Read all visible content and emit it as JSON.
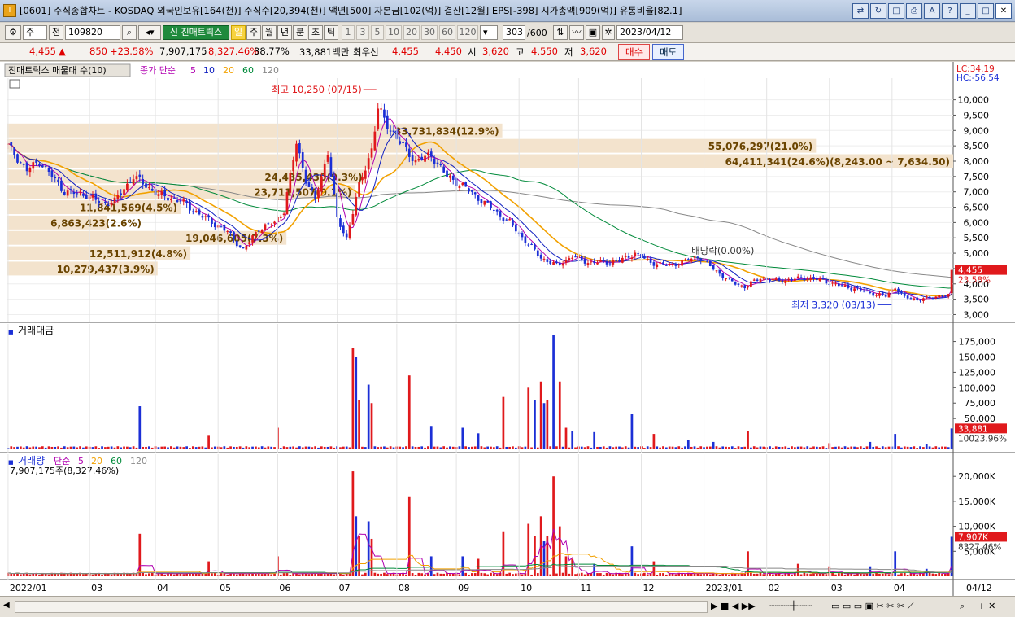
{
  "window": {
    "title": "[0601] 주식종합차트 - KOSDAQ 외국인보유[164(천)] 주식수[20,394(천)] 액면[500] 자본금[102(억)] 결산[12월] EPS[-398] 시가총액[909(억)] 유통비율[82.1]",
    "icon": "I"
  },
  "toolbar": {
    "mode": "주",
    "ex_label": "전",
    "code": "109820",
    "tracks_button": "신 진매트릭스",
    "periods": [
      "일",
      "주",
      "월",
      "년",
      "분",
      "초",
      "틱"
    ],
    "active_period": "일",
    "minute_options": [
      "1",
      "3",
      "5",
      "10",
      "20",
      "30",
      "60",
      "120"
    ],
    "count": "303",
    "count_total": "/600",
    "date": "2023/04/12"
  },
  "quote": {
    "price": "4,455",
    "change": "850",
    "change_pct": "+23.58%",
    "volume": "7,907,175",
    "volume_pct": "8,327.46%",
    "ratio": "38.77%",
    "amount": "33,881백만",
    "best_label": "최우선",
    "best_ask": "4,455",
    "best_bid": "4,450",
    "open_label": "시",
    "open": "3,620",
    "high_label": "고",
    "high": "4,550",
    "low_label": "저",
    "low": "3,620",
    "buy_label": "매수",
    "sell_label": "매도"
  },
  "colors": {
    "up": "#e0191c",
    "down": "#1b2fd6",
    "ma5": "#b000b0",
    "ma10": "#1020c0",
    "ma20": "#f2a100",
    "ma60": "#008a3a",
    "ma120": "#888888",
    "volume_profile": "#f3e3cd"
  },
  "chart_data": [
    {
      "type": "candlestick",
      "panel": "price",
      "legend_title": "진매트릭스 매물대 수(10)",
      "ma_label": "종가 단순",
      "ma_periods": [
        "5",
        "10",
        "20",
        "60",
        "120"
      ],
      "ylim": [
        2800,
        10600
      ],
      "yticks": [
        "10,000",
        "9,500",
        "9,000",
        "8,500",
        "8,000",
        "7,500",
        "7,000",
        "6,500",
        "6,000",
        "5,500",
        "5,000",
        "4,500",
        "4,000",
        "3,500",
        "3,000"
      ],
      "ytick_values": [
        10000,
        9500,
        9000,
        8500,
        8000,
        7500,
        7000,
        6500,
        6000,
        5500,
        5000,
        4500,
        4000,
        3500,
        3000
      ],
      "x_labels": [
        "2022/01",
        "03",
        "04",
        "05",
        "06",
        "07",
        "08",
        "09",
        "10",
        "11",
        "12",
        "2023/01",
        "02",
        "03",
        "04",
        "04/12"
      ],
      "right_top_labels": [
        "LC:34.19",
        "HC:-56.54"
      ],
      "current_price_label": "4,455",
      "current_pct_label": "23.58%",
      "current_price": 4455,
      "max_annotation": "최고 10,250 (07/15)",
      "min_annotation": "최저 3,320 (03/13)",
      "dividend_annotation": "배당락(0.00%)",
      "price_keypoints": [
        [
          0,
          8500
        ],
        [
          6,
          7700
        ],
        [
          10,
          8000
        ],
        [
          18,
          7000
        ],
        [
          25,
          6900
        ],
        [
          30,
          6600
        ],
        [
          34,
          6700
        ],
        [
          40,
          7500
        ],
        [
          48,
          6900
        ],
        [
          55,
          6700
        ],
        [
          62,
          6200
        ],
        [
          70,
          5700
        ],
        [
          75,
          5100
        ],
        [
          80,
          5800
        ],
        [
          85,
          6000
        ],
        [
          88,
          6400
        ],
        [
          92,
          8600
        ],
        [
          95,
          7400
        ],
        [
          98,
          6700
        ],
        [
          102,
          8300
        ],
        [
          105,
          6100
        ],
        [
          108,
          5500
        ],
        [
          112,
          7200
        ],
        [
          116,
          8400
        ],
        [
          118,
          9700
        ],
        [
          121,
          9200
        ],
        [
          125,
          8600
        ],
        [
          130,
          8000
        ],
        [
          135,
          8200
        ],
        [
          140,
          7500
        ],
        [
          145,
          7200
        ],
        [
          150,
          6800
        ],
        [
          155,
          6400
        ],
        [
          160,
          6000
        ],
        [
          165,
          5400
        ],
        [
          170,
          4850
        ],
        [
          175,
          4600
        ],
        [
          180,
          4900
        ],
        [
          185,
          4700
        ],
        [
          190,
          4700
        ],
        [
          195,
          4750
        ],
        [
          200,
          5000
        ],
        [
          205,
          4700
        ],
        [
          210,
          4600
        ],
        [
          215,
          4700
        ],
        [
          220,
          4900
        ],
        [
          225,
          4500
        ],
        [
          230,
          4100
        ],
        [
          235,
          3900
        ],
        [
          240,
          4200
        ],
        [
          245,
          4100
        ],
        [
          250,
          4150
        ],
        [
          255,
          4200
        ],
        [
          260,
          4100
        ],
        [
          265,
          3950
        ],
        [
          270,
          3850
        ],
        [
          275,
          3700
        ],
        [
          280,
          3600
        ],
        [
          283,
          3900
        ],
        [
          286,
          3550
        ],
        [
          290,
          3500
        ],
        [
          295,
          3550
        ],
        [
          298,
          3650
        ],
        [
          300,
          3605
        ],
        [
          301,
          4455
        ]
      ],
      "volume_profile": [
        {
          "label": "33,731,834(12.9%)",
          "price": 9000,
          "amount": 33731834
        },
        {
          "label": "55,076,297(21.0%)",
          "price": 8500,
          "amount": 55076297
        },
        {
          "label": "64,411,341(24.6%)(8,243.00 ~ 7,634.50)",
          "price": 8000,
          "amount": 64411341
        },
        {
          "label": "24,435,430(9.3%)",
          "price": 7500,
          "amount": 24435430
        },
        {
          "label": "23,711,507(9.1%)",
          "price": 7000,
          "amount": 23711507
        },
        {
          "label": "11,841,569(4.5%)",
          "price": 6500,
          "amount": 11841569
        },
        {
          "label": "6,863,423(2.6%)",
          "price": 6000,
          "amount": 6863423
        },
        {
          "label": "19,046,605(7.3%)",
          "price": 5500,
          "amount": 19046605
        },
        {
          "label": "12,511,912(4.8%)",
          "price": 5000,
          "amount": 12511912
        },
        {
          "label": "10,279,437(3.9%)",
          "price": 4500,
          "amount": 10279437
        }
      ]
    },
    {
      "type": "bar",
      "panel": "amount",
      "title": "거래대금",
      "ylim": [
        0,
        185000
      ],
      "yticks": [
        "175,000",
        "150,000",
        "125,000",
        "100,000",
        "75,000",
        "50,000"
      ],
      "ytick_values": [
        175000,
        150000,
        125000,
        100000,
        75000,
        50000
      ],
      "current_label": "33,881",
      "ma_label": "10023.96%",
      "spikes": [
        [
          42,
          70000
        ],
        [
          64,
          22000
        ],
        [
          86,
          35000
        ],
        [
          110,
          165000
        ],
        [
          111,
          150000
        ],
        [
          112,
          80000
        ],
        [
          115,
          105000
        ],
        [
          116,
          75000
        ],
        [
          128,
          120000
        ],
        [
          135,
          38000
        ],
        [
          145,
          35000
        ],
        [
          150,
          26000
        ],
        [
          158,
          85000
        ],
        [
          166,
          100000
        ],
        [
          168,
          80000
        ],
        [
          170,
          110000
        ],
        [
          171,
          75000
        ],
        [
          172,
          80000
        ],
        [
          174,
          185000
        ],
        [
          176,
          110000
        ],
        [
          178,
          35000
        ],
        [
          180,
          30000
        ],
        [
          187,
          28000
        ],
        [
          199,
          58000
        ],
        [
          206,
          25000
        ],
        [
          217,
          15000
        ],
        [
          225,
          12000
        ],
        [
          236,
          30000
        ],
        [
          262,
          10000
        ],
        [
          275,
          12000
        ],
        [
          283,
          25000
        ],
        [
          293,
          8000
        ],
        [
          301,
          33881
        ]
      ]
    },
    {
      "type": "bar",
      "panel": "volume",
      "title": "거래량",
      "ma_label": "단순",
      "ma_periods": [
        "5",
        "20",
        "60",
        "120"
      ],
      "subtitle": "7,907,175주(8,327.46%)",
      "ylim": [
        0,
        21500000
      ],
      "yticks": [
        "20,000K",
        "15,000K",
        "10,000K",
        "5,000K"
      ],
      "ytick_values": [
        20000000,
        15000000,
        10000000,
        5000000
      ],
      "current_label": "7,907K",
      "ma_pct_label": "8327.46%",
      "spikes": [
        [
          42,
          8500000
        ],
        [
          64,
          3000000
        ],
        [
          86,
          4000000
        ],
        [
          110,
          21000000
        ],
        [
          111,
          12000000
        ],
        [
          112,
          8000000
        ],
        [
          115,
          11000000
        ],
        [
          116,
          7500000
        ],
        [
          128,
          16000000
        ],
        [
          135,
          4000000
        ],
        [
          145,
          4000000
        ],
        [
          150,
          3500000
        ],
        [
          158,
          9000000
        ],
        [
          166,
          10500000
        ],
        [
          168,
          8000000
        ],
        [
          170,
          12000000
        ],
        [
          171,
          7000000
        ],
        [
          172,
          8000000
        ],
        [
          174,
          20000000
        ],
        [
          176,
          10000000
        ],
        [
          178,
          4000000
        ],
        [
          180,
          3500000
        ],
        [
          187,
          2500000
        ],
        [
          199,
          6000000
        ],
        [
          206,
          3000000
        ],
        [
          236,
          5000000
        ],
        [
          252,
          2500000
        ],
        [
          262,
          2000000
        ],
        [
          275,
          2000000
        ],
        [
          283,
          5000000
        ],
        [
          293,
          1500000
        ],
        [
          301,
          7907175
        ]
      ]
    }
  ],
  "scrollbar": {
    "left_arrow": "◀"
  }
}
